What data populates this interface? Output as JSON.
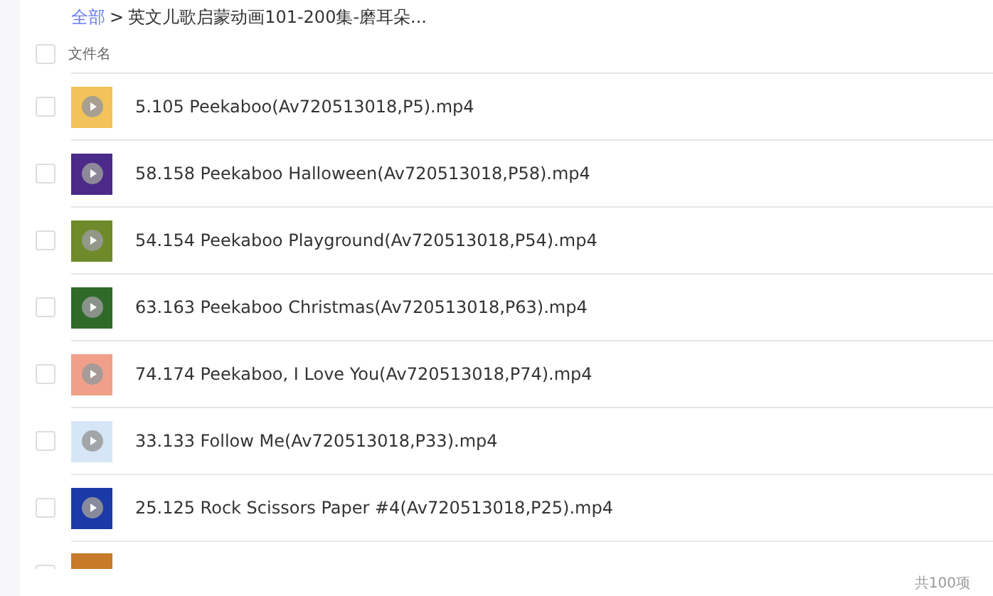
{
  "breadcrumb": {
    "root": "全部",
    "separator": ">",
    "current": "英文儿歌启蒙动画101-200集-磨耳朵..."
  },
  "header": {
    "checked": false,
    "column": "文件名"
  },
  "files": [
    {
      "name": "5.105 Peekaboo(Av720513018,P5).mp4",
      "checked": false,
      "color": "#f2c35a"
    },
    {
      "name": "58.158 Peekaboo Halloween(Av720513018,P58).mp4",
      "checked": false,
      "color": "#4b2a8a"
    },
    {
      "name": "54.154 Peekaboo Playground(Av720513018,P54).mp4",
      "checked": false,
      "color": "#6f8a2a"
    },
    {
      "name": "63.163 Peekaboo Christmas(Av720513018,P63).mp4",
      "checked": false,
      "color": "#2f6a2a"
    },
    {
      "name": "74.174 Peekaboo, I Love You(Av720513018,P74).mp4",
      "checked": false,
      "color": "#f0a08a"
    },
    {
      "name": "33.133 Follow Me(Av720513018,P33).mp4",
      "checked": false,
      "color": "#d6e6f7"
    },
    {
      "name": "25.125 Rock Scissors Paper #4(Av720513018,P25).mp4",
      "checked": false,
      "color": "#1b3aa8"
    }
  ],
  "partial_row": {
    "checked": false,
    "color": "#c77a2a"
  },
  "footer": {
    "count": "共100项"
  }
}
